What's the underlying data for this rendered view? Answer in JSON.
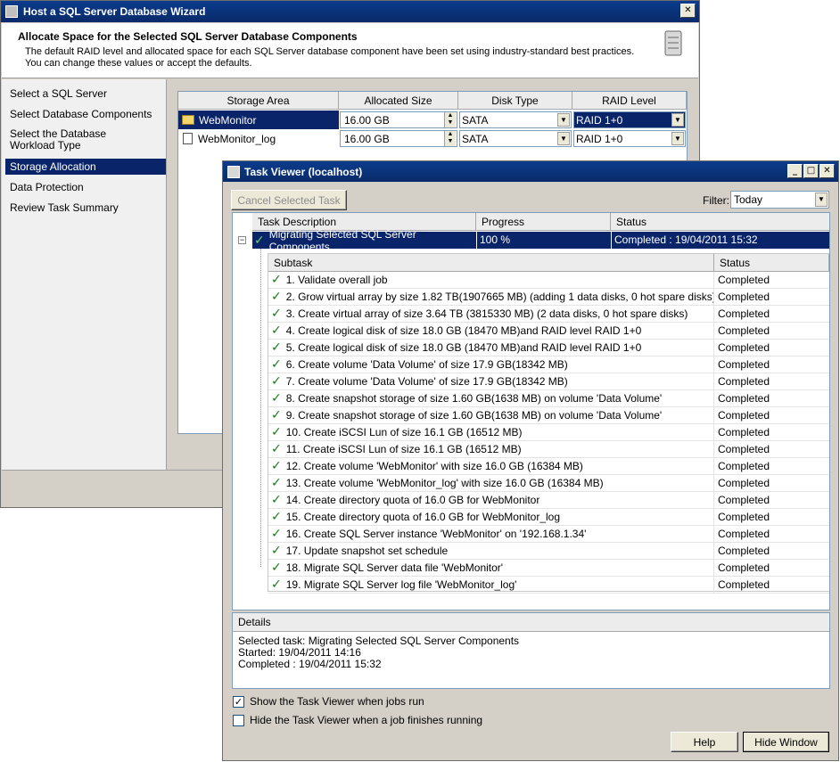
{
  "wizard": {
    "title": "Host a SQL Server Database Wizard",
    "heading": "Allocate Space for the Selected SQL Server Database Components",
    "description_line1": "The default RAID level and allocated space for each SQL Server database component have been set using industry-standard best practices.",
    "description_line2": "You can change these values or accept the defaults.",
    "nav": [
      {
        "label": "Select a SQL Server"
      },
      {
        "label": "Select Database Components"
      },
      {
        "label": "Select the Database Workload Type"
      },
      {
        "label": "Storage Allocation"
      },
      {
        "label": "Data Protection"
      },
      {
        "label": "Review Task Summary"
      }
    ],
    "nav_selected_index": 3,
    "grid_headers": [
      "Storage Area",
      "Allocated Size",
      "Disk Type",
      "RAID Level"
    ],
    "rows": [
      {
        "area": "WebMonitor",
        "size": "16.00 GB",
        "disk": "SATA",
        "raid": "RAID 1+0"
      },
      {
        "area": "WebMonitor_log",
        "size": "16.00 GB",
        "disk": "SATA",
        "raid": "RAID 1+0"
      }
    ]
  },
  "taskviewer": {
    "title": "Task Viewer (localhost)",
    "cancel_label": "Cancel Selected Task",
    "filter_label": "Filter:",
    "filter_value": "Today",
    "headers": [
      "Task Description",
      "Progress",
      "Status"
    ],
    "task": {
      "description": "Migrating Selected SQL Server Components",
      "progress": "100 %",
      "status": "Completed : 19/04/2011 15:32"
    },
    "subtask_headers": [
      "Subtask",
      "Status"
    ],
    "subtasks": [
      {
        "text": "1. Validate overall job",
        "status": "Completed"
      },
      {
        "text": "2. Grow virtual array by size 1.82 TB(1907665 MB) (adding 1 data disks, 0 hot spare disks)",
        "status": "Completed"
      },
      {
        "text": "3. Create virtual array of size 3.64 TB (3815330 MB) (2 data disks, 0 hot spare disks)",
        "status": "Completed"
      },
      {
        "text": "4. Create logical disk of size 18.0 GB (18470 MB)and RAID level RAID 1+0",
        "status": "Completed"
      },
      {
        "text": "5. Create logical disk of size 18.0 GB (18470 MB)and RAID level RAID 1+0",
        "status": "Completed"
      },
      {
        "text": "6. Create volume 'Data Volume' of size 17.9 GB(18342 MB)",
        "status": "Completed"
      },
      {
        "text": "7. Create volume 'Data Volume' of size 17.9 GB(18342 MB)",
        "status": "Completed"
      },
      {
        "text": "8. Create snapshot storage of size 1.60 GB(1638 MB) on volume 'Data Volume'",
        "status": "Completed"
      },
      {
        "text": "9. Create snapshot storage of size 1.60 GB(1638 MB) on volume 'Data Volume'",
        "status": "Completed"
      },
      {
        "text": "10. Create iSCSI Lun of size 16.1 GB (16512 MB)",
        "status": "Completed"
      },
      {
        "text": "11. Create iSCSI Lun of size 16.1 GB (16512 MB)",
        "status": "Completed"
      },
      {
        "text": "12. Create volume 'WebMonitor' with size 16.0 GB (16384 MB)",
        "status": "Completed"
      },
      {
        "text": "13. Create volume 'WebMonitor_log' with size 16.0 GB (16384 MB)",
        "status": "Completed"
      },
      {
        "text": "14. Create directory quota of 16.0 GB for WebMonitor",
        "status": "Completed"
      },
      {
        "text": "15. Create directory quota of 16.0 GB for WebMonitor_log",
        "status": "Completed"
      },
      {
        "text": "16. Create SQL Server instance 'WebMonitor' on '192.168.1.34'",
        "status": "Completed"
      },
      {
        "text": "17. Update snapshot set schedule",
        "status": "Completed"
      },
      {
        "text": "18. Migrate SQL Server data file 'WebMonitor'",
        "status": "Completed"
      },
      {
        "text": "19. Migrate SQL Server log file 'WebMonitor_log'",
        "status": "Completed"
      }
    ],
    "details_label": "Details",
    "details_line1": "Selected task: Migrating Selected SQL Server Components",
    "details_line2": "Started: 19/04/2011 14:16",
    "details_line3": "Completed : 19/04/2011 15:32",
    "show_viewer_label": "Show the Task Viewer when jobs run",
    "show_viewer_checked": true,
    "hide_viewer_label": "Hide the Task Viewer when a job finishes running",
    "hide_viewer_checked": false,
    "help_label": "Help",
    "hide_window_label": "Hide Window"
  },
  "icons": {
    "close": "close-icon",
    "minimize": "minimize-icon",
    "maximize": "maximize-icon",
    "check": "check-icon",
    "server": "server-icon",
    "folder": "folder-icon",
    "log": "log-file-icon"
  },
  "colors": {
    "title_bar": "#0a2a6a",
    "selection": "#0a246a",
    "check_green": "#1b7a1b",
    "window_bg": "#d4d0c8"
  }
}
